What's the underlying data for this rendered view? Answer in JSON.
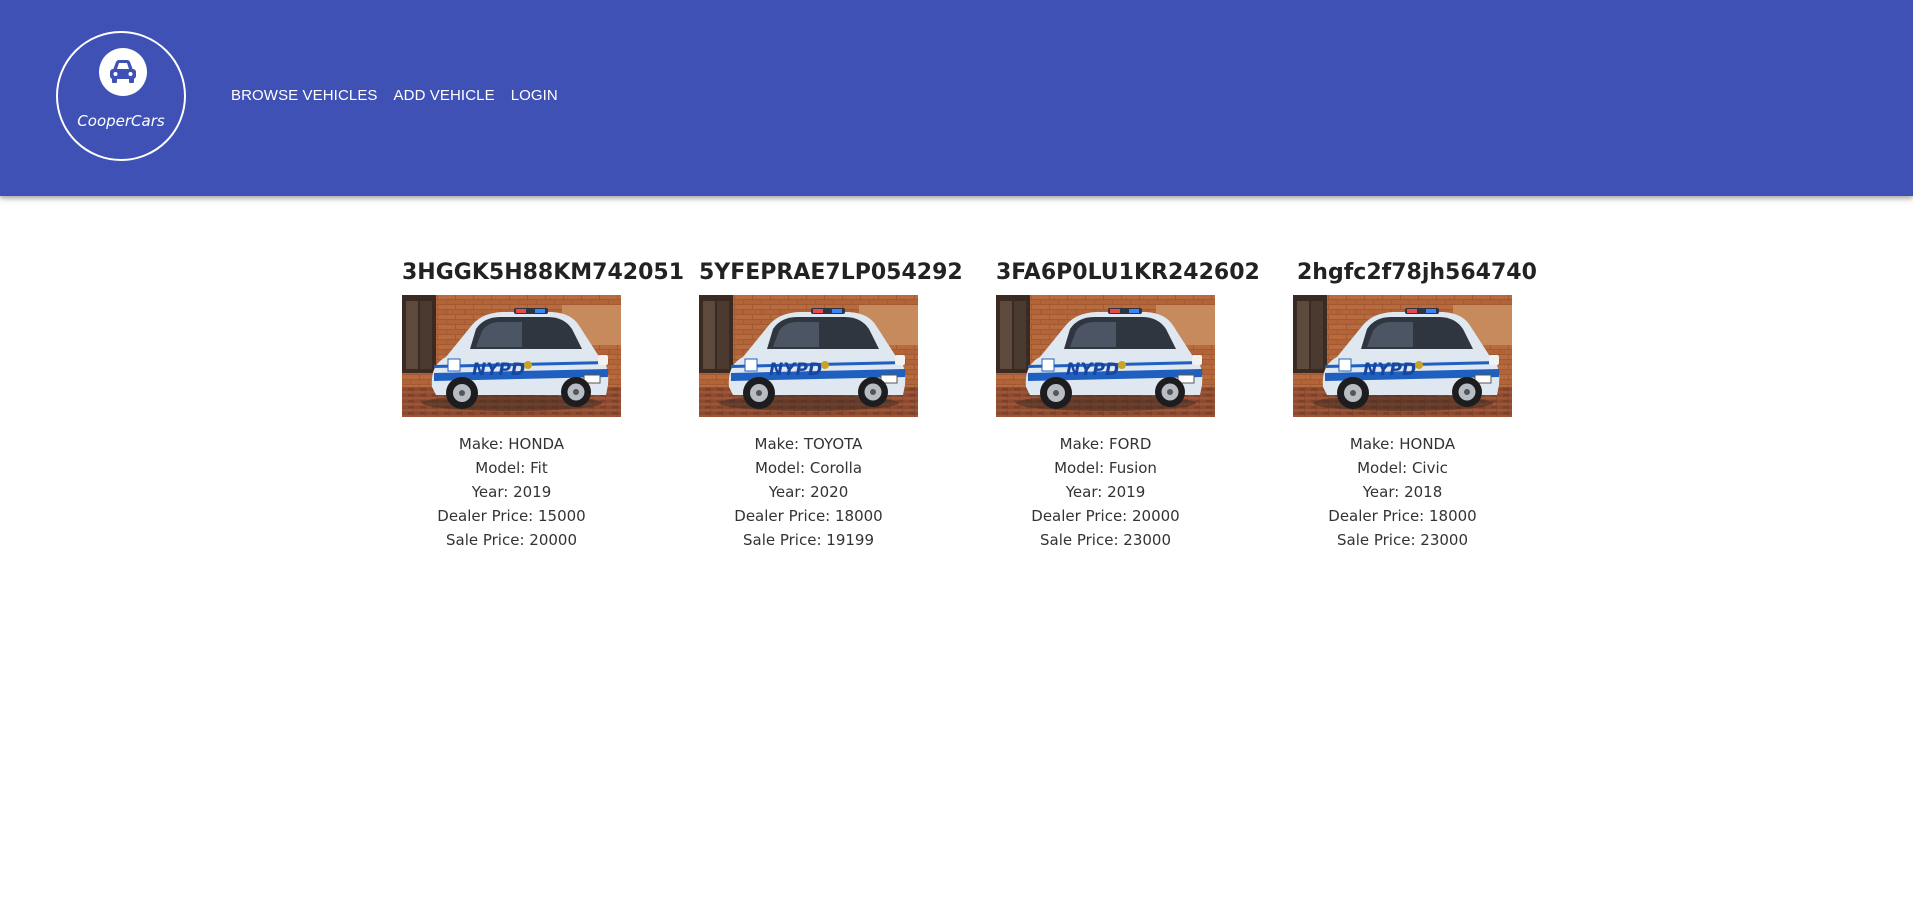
{
  "header": {
    "logo_text": "CooperCars",
    "logo_icon": "car-icon",
    "nav": [
      {
        "label": "BROWSE VEHICLES"
      },
      {
        "label": "ADD VEHICLE"
      },
      {
        "label": "LOGIN"
      }
    ]
  },
  "colors": {
    "header_bg": "#3f51b5",
    "text": "#333333"
  },
  "vehicles": [
    {
      "vin": "3HGGK5H88KM742051",
      "make": "Make: HONDA",
      "model": "Model: Fit",
      "year": "Year: 2019",
      "dealer_price": "Dealer Price: 15000",
      "sale_price": "Sale Price: 20000",
      "image": "nypd-police-smart-car"
    },
    {
      "vin": "5YFEPRAE7LP054292",
      "make": "Make: TOYOTA",
      "model": "Model: Corolla",
      "year": "Year: 2020",
      "dealer_price": "Dealer Price: 18000",
      "sale_price": "Sale Price: 19199",
      "image": "nypd-police-smart-car"
    },
    {
      "vin": "3FA6P0LU1KR242602",
      "make": "Make: FORD",
      "model": "Model: Fusion",
      "year": "Year: 2019",
      "dealer_price": "Dealer Price: 20000",
      "sale_price": "Sale Price: 23000",
      "image": "nypd-police-smart-car"
    },
    {
      "vin": "2hgfc2f78jh564740",
      "make": "Make: HONDA",
      "model": "Model: Civic",
      "year": "Year: 2018",
      "dealer_price": "Dealer Price: 18000",
      "sale_price": "Sale Price: 23000",
      "image": "nypd-police-smart-car"
    }
  ]
}
